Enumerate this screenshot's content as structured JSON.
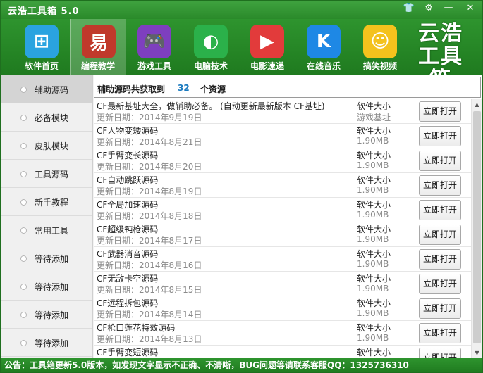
{
  "window": {
    "title": "云浩工具箱 5.0",
    "controls": {
      "skin": "👕",
      "settings": "⚙",
      "minimize": "—",
      "close": "✕"
    }
  },
  "nav": [
    {
      "label": "软件首页",
      "icon": "windows-logo-icon",
      "color": "#2aa3e0"
    },
    {
      "label": "编程教学",
      "icon": "code-tutorial-icon",
      "color": "#c0392b",
      "active": true
    },
    {
      "label": "游戏工具",
      "icon": "gamepad-icon",
      "color": "#7e3fbf"
    },
    {
      "label": "电脑技术",
      "icon": "computer-tech-icon",
      "color": "#2bb14a"
    },
    {
      "label": "电影速递",
      "icon": "movie-clapper-icon",
      "color": "#e23b3b"
    },
    {
      "label": "在线音乐",
      "icon": "music-k-icon",
      "color": "#1e88e5"
    },
    {
      "label": "搞笑视频",
      "icon": "funny-face-icon",
      "color": "#f4c21d"
    }
  ],
  "brand": {
    "line1": "云浩",
    "line2": "工具箱"
  },
  "sidebar": [
    {
      "label": "辅助源码",
      "active": true
    },
    {
      "label": "必备模块"
    },
    {
      "label": "皮肤模块"
    },
    {
      "label": "工具源码"
    },
    {
      "label": "新手教程"
    },
    {
      "label": "常用工具"
    },
    {
      "label": "等待添加"
    },
    {
      "label": "等待添加"
    },
    {
      "label": "等待添加"
    },
    {
      "label": "等待添加"
    }
  ],
  "summary": {
    "prefix": "辅助源码共获取到",
    "count": "32",
    "suffix": "个资源"
  },
  "list": [
    {
      "name": "CF最新基址大全，做辅助必备。 (自动更新最新版本 CF基址)",
      "date": "更新日期：2014年9月19日",
      "size_label": "软件大小",
      "size": "游戏基址",
      "button": "立即打开"
    },
    {
      "name": "CF人物变矮源码",
      "date": "更新日期：2014年8月21日",
      "size_label": "软件大小",
      "size": "1.90MB",
      "button": "立即打开"
    },
    {
      "name": "CF手臂变长源码",
      "date": "更新日期：2014年8月20日",
      "size_label": "软件大小",
      "size": "1.90MB",
      "button": "立即打开"
    },
    {
      "name": "CF自动跳跃源码",
      "date": "更新日期：2014年8月19日",
      "size_label": "软件大小",
      "size": "1.90MB",
      "button": "立即打开"
    },
    {
      "name": "CF全局加速源码",
      "date": "更新日期：2014年8月18日",
      "size_label": "软件大小",
      "size": "1.90MB",
      "button": "立即打开"
    },
    {
      "name": "CF超级钝枪源码",
      "date": "更新日期：2014年8月17日",
      "size_label": "软件大小",
      "size": "1.90MB",
      "button": "立即打开"
    },
    {
      "name": "CF武器消音源码",
      "date": "更新日期：2014年8月16日",
      "size_label": "软件大小",
      "size": "1.90MB",
      "button": "立即打开"
    },
    {
      "name": "CF无敌卡空源码",
      "date": "更新日期：2014年8月15日",
      "size_label": "软件大小",
      "size": "1.90MB",
      "button": "立即打开"
    },
    {
      "name": "CF远程拆包源码",
      "date": "更新日期：2014年8月14日",
      "size_label": "软件大小",
      "size": "1.90MB",
      "button": "立即打开"
    },
    {
      "name": "CF枪口莲花特效源码",
      "date": "更新日期：2014年8月13日",
      "size_label": "软件大小",
      "size": "1.90MB",
      "button": "立即打开"
    },
    {
      "name": "CF手臂变短源码",
      "date": "",
      "size_label": "软件大小",
      "size": "",
      "button": "立即打开"
    }
  ],
  "statusbar": {
    "text": "公告：工具箱更新5.0版本，如发现文字显示不正确、不清晰，BUG问题等请联系客服QQ：1325736310"
  }
}
